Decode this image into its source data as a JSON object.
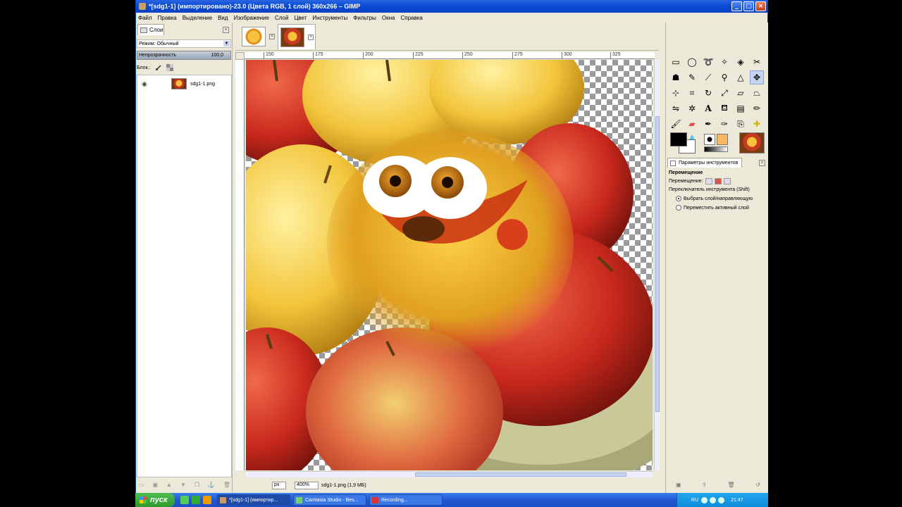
{
  "window": {
    "title": "*[sdg1-1] (импортировано)-23.0 (Цвета RGB, 1 слой) 360x266 – GIMP",
    "controls": {
      "minimize": "_",
      "maximize": "□",
      "close": "×"
    }
  },
  "menu": [
    "Файл",
    "Правка",
    "Выделение",
    "Вид",
    "Изображение",
    "Слой",
    "Цвет",
    "Инструменты",
    "Фильтры",
    "Окна",
    "Справка"
  ],
  "layers_panel": {
    "tab_label": "Слои",
    "mode_label": "Режим: Обычный",
    "opacity_label": "Непрозрачность",
    "opacity_value": "100,0",
    "lock_label": "Блок.:",
    "layers": [
      {
        "name": "sdg1-1.png",
        "visible": true
      }
    ]
  },
  "canvas": {
    "ruler_ticks": [
      "150",
      "175",
      "200",
      "225",
      "250",
      "275",
      "300",
      "325"
    ],
    "status_unit": "px",
    "status_zoom": "400%",
    "status_text": "sdg1-1.png (1,9 МБ)"
  },
  "toolbox": {
    "tool_icons": [
      "rect-select-icon",
      "ellipse-select-icon",
      "lasso-icon",
      "fuzzy-select-icon",
      "color-select-icon",
      "scissors-icon",
      "foreground-select-icon",
      "paths-icon",
      "color-picker-icon",
      "zoom-icon",
      "measure-icon",
      "move-icon",
      "align-icon",
      "crop-icon",
      "rotate-icon",
      "scale-icon",
      "shear-icon",
      "perspective-icon",
      "flip-icon",
      "cage-icon",
      "text-icon",
      "bucket-fill-icon",
      "blend-icon",
      "pencil-icon",
      "paintbrush-icon",
      "eraser-icon",
      "airbrush-icon",
      "ink-icon",
      "clone-icon",
      "heal-icon",
      "perspective-clone-icon",
      "blur-icon",
      "smudge-icon",
      "dodge-burn-icon"
    ],
    "options_tab_label": "Параметры инструментов",
    "options_title": "Перемещение",
    "move_label": "Перемещение:",
    "switch_label": "Переключатель инструмента (Shift)",
    "radio_options": [
      {
        "label": "Выбрать слой/направляющую",
        "checked": true
      },
      {
        "label": "Переместить активный слой",
        "checked": false
      }
    ],
    "colors": {
      "foreground": "#000000",
      "background": "#ffffff"
    }
  },
  "taskbar": {
    "start_label": "пуск",
    "tasks": [
      {
        "label": "*[sdg1-1] (импортир...",
        "active": true
      },
      {
        "label": "Camtasia Studio - Bes...",
        "active": false
      },
      {
        "label": "Recording...",
        "active": false
      }
    ],
    "lang": "RU",
    "clock": "21:47"
  }
}
